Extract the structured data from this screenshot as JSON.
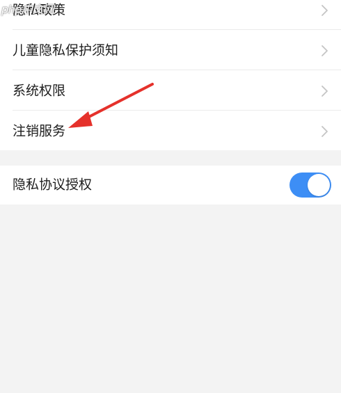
{
  "watermark": "php中文网",
  "settings_group_1": {
    "items": [
      {
        "label": "隐私政策",
        "icon": "chevron-right-icon"
      },
      {
        "label": "儿童隐私保护须知",
        "icon": "chevron-right-icon"
      },
      {
        "label": "系统权限",
        "icon": "chevron-right-icon"
      },
      {
        "label": "注销服务",
        "icon": "chevron-right-icon"
      }
    ]
  },
  "settings_group_2": {
    "privacy_authorization": {
      "label": "隐私协议授权",
      "toggle_state": "on"
    }
  },
  "colors": {
    "toggle_on": "#3d8ef5",
    "annotation_arrow": "#e5312b",
    "background": "#f3f3f3"
  }
}
